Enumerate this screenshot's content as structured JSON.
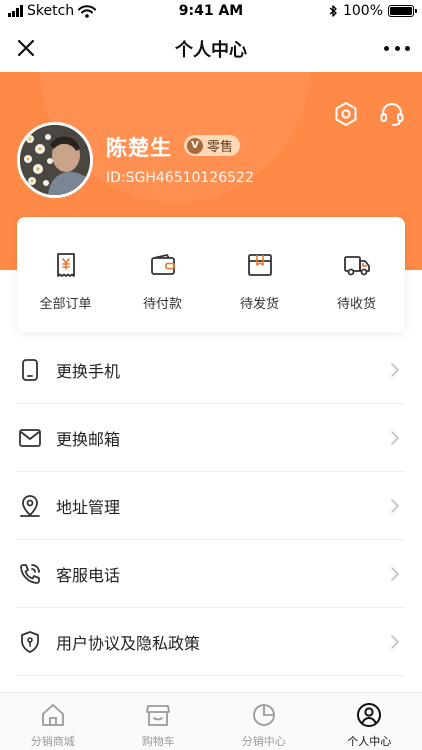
{
  "status_bar": {
    "carrier": "Sketch",
    "time": "9:41 AM",
    "battery": "100%"
  },
  "nav": {
    "title": "个人中心"
  },
  "profile": {
    "name": "陈楚生",
    "badge": "零售",
    "badge_mark": "V",
    "user_id": "ID:SGH46510126522"
  },
  "orders": [
    {
      "label": "全部订单",
      "icon": "receipt-yen-icon"
    },
    {
      "label": "待付款",
      "icon": "wallet-icon"
    },
    {
      "label": "待发货",
      "icon": "box-icon"
    },
    {
      "label": "待收货",
      "icon": "truck-icon"
    }
  ],
  "menu": [
    {
      "label": "更换手机",
      "icon": "phone-icon"
    },
    {
      "label": "更换邮箱",
      "icon": "mail-icon"
    },
    {
      "label": "地址管理",
      "icon": "location-pin-icon"
    },
    {
      "label": "客服电话",
      "icon": "phone-call-icon"
    },
    {
      "label": "用户协议及隐私政策",
      "icon": "shield-icon"
    }
  ],
  "tabs": [
    {
      "label": "分销商城",
      "icon": "home-icon",
      "active": false
    },
    {
      "label": "购物车",
      "icon": "store-icon",
      "active": false
    },
    {
      "label": "分销中心",
      "icon": "pie-chart-icon",
      "active": false
    },
    {
      "label": "个人中心",
      "icon": "user-icon",
      "active": true
    }
  ],
  "colors": {
    "accent": "#ff8a47",
    "badge_bg": "#ffd9b8",
    "text": "#222222",
    "tab_inactive": "#9a9a9a"
  }
}
